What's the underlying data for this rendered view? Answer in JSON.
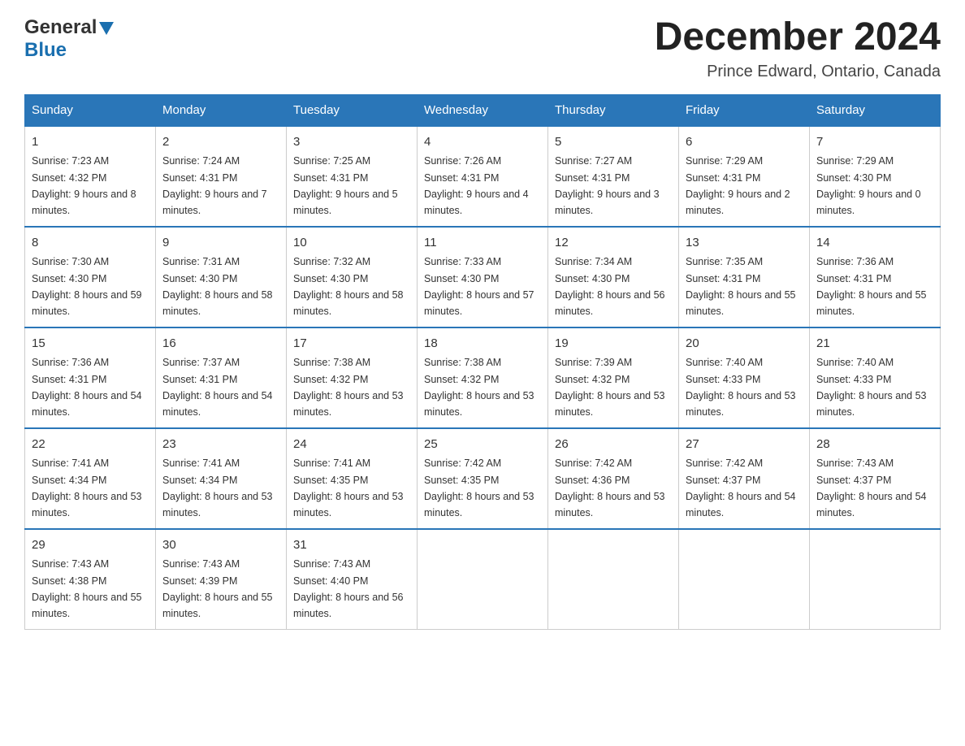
{
  "header": {
    "logo_general": "General",
    "logo_blue": "Blue",
    "title": "December 2024",
    "subtitle": "Prince Edward, Ontario, Canada"
  },
  "columns": [
    "Sunday",
    "Monday",
    "Tuesday",
    "Wednesday",
    "Thursday",
    "Friday",
    "Saturday"
  ],
  "weeks": [
    [
      {
        "day": "1",
        "sunrise": "Sunrise: 7:23 AM",
        "sunset": "Sunset: 4:32 PM",
        "daylight": "Daylight: 9 hours and 8 minutes."
      },
      {
        "day": "2",
        "sunrise": "Sunrise: 7:24 AM",
        "sunset": "Sunset: 4:31 PM",
        "daylight": "Daylight: 9 hours and 7 minutes."
      },
      {
        "day": "3",
        "sunrise": "Sunrise: 7:25 AM",
        "sunset": "Sunset: 4:31 PM",
        "daylight": "Daylight: 9 hours and 5 minutes."
      },
      {
        "day": "4",
        "sunrise": "Sunrise: 7:26 AM",
        "sunset": "Sunset: 4:31 PM",
        "daylight": "Daylight: 9 hours and 4 minutes."
      },
      {
        "day": "5",
        "sunrise": "Sunrise: 7:27 AM",
        "sunset": "Sunset: 4:31 PM",
        "daylight": "Daylight: 9 hours and 3 minutes."
      },
      {
        "day": "6",
        "sunrise": "Sunrise: 7:29 AM",
        "sunset": "Sunset: 4:31 PM",
        "daylight": "Daylight: 9 hours and 2 minutes."
      },
      {
        "day": "7",
        "sunrise": "Sunrise: 7:29 AM",
        "sunset": "Sunset: 4:30 PM",
        "daylight": "Daylight: 9 hours and 0 minutes."
      }
    ],
    [
      {
        "day": "8",
        "sunrise": "Sunrise: 7:30 AM",
        "sunset": "Sunset: 4:30 PM",
        "daylight": "Daylight: 8 hours and 59 minutes."
      },
      {
        "day": "9",
        "sunrise": "Sunrise: 7:31 AM",
        "sunset": "Sunset: 4:30 PM",
        "daylight": "Daylight: 8 hours and 58 minutes."
      },
      {
        "day": "10",
        "sunrise": "Sunrise: 7:32 AM",
        "sunset": "Sunset: 4:30 PM",
        "daylight": "Daylight: 8 hours and 58 minutes."
      },
      {
        "day": "11",
        "sunrise": "Sunrise: 7:33 AM",
        "sunset": "Sunset: 4:30 PM",
        "daylight": "Daylight: 8 hours and 57 minutes."
      },
      {
        "day": "12",
        "sunrise": "Sunrise: 7:34 AM",
        "sunset": "Sunset: 4:30 PM",
        "daylight": "Daylight: 8 hours and 56 minutes."
      },
      {
        "day": "13",
        "sunrise": "Sunrise: 7:35 AM",
        "sunset": "Sunset: 4:31 PM",
        "daylight": "Daylight: 8 hours and 55 minutes."
      },
      {
        "day": "14",
        "sunrise": "Sunrise: 7:36 AM",
        "sunset": "Sunset: 4:31 PM",
        "daylight": "Daylight: 8 hours and 55 minutes."
      }
    ],
    [
      {
        "day": "15",
        "sunrise": "Sunrise: 7:36 AM",
        "sunset": "Sunset: 4:31 PM",
        "daylight": "Daylight: 8 hours and 54 minutes."
      },
      {
        "day": "16",
        "sunrise": "Sunrise: 7:37 AM",
        "sunset": "Sunset: 4:31 PM",
        "daylight": "Daylight: 8 hours and 54 minutes."
      },
      {
        "day": "17",
        "sunrise": "Sunrise: 7:38 AM",
        "sunset": "Sunset: 4:32 PM",
        "daylight": "Daylight: 8 hours and 53 minutes."
      },
      {
        "day": "18",
        "sunrise": "Sunrise: 7:38 AM",
        "sunset": "Sunset: 4:32 PM",
        "daylight": "Daylight: 8 hours and 53 minutes."
      },
      {
        "day": "19",
        "sunrise": "Sunrise: 7:39 AM",
        "sunset": "Sunset: 4:32 PM",
        "daylight": "Daylight: 8 hours and 53 minutes."
      },
      {
        "day": "20",
        "sunrise": "Sunrise: 7:40 AM",
        "sunset": "Sunset: 4:33 PM",
        "daylight": "Daylight: 8 hours and 53 minutes."
      },
      {
        "day": "21",
        "sunrise": "Sunrise: 7:40 AM",
        "sunset": "Sunset: 4:33 PM",
        "daylight": "Daylight: 8 hours and 53 minutes."
      }
    ],
    [
      {
        "day": "22",
        "sunrise": "Sunrise: 7:41 AM",
        "sunset": "Sunset: 4:34 PM",
        "daylight": "Daylight: 8 hours and 53 minutes."
      },
      {
        "day": "23",
        "sunrise": "Sunrise: 7:41 AM",
        "sunset": "Sunset: 4:34 PM",
        "daylight": "Daylight: 8 hours and 53 minutes."
      },
      {
        "day": "24",
        "sunrise": "Sunrise: 7:41 AM",
        "sunset": "Sunset: 4:35 PM",
        "daylight": "Daylight: 8 hours and 53 minutes."
      },
      {
        "day": "25",
        "sunrise": "Sunrise: 7:42 AM",
        "sunset": "Sunset: 4:35 PM",
        "daylight": "Daylight: 8 hours and 53 minutes."
      },
      {
        "day": "26",
        "sunrise": "Sunrise: 7:42 AM",
        "sunset": "Sunset: 4:36 PM",
        "daylight": "Daylight: 8 hours and 53 minutes."
      },
      {
        "day": "27",
        "sunrise": "Sunrise: 7:42 AM",
        "sunset": "Sunset: 4:37 PM",
        "daylight": "Daylight: 8 hours and 54 minutes."
      },
      {
        "day": "28",
        "sunrise": "Sunrise: 7:43 AM",
        "sunset": "Sunset: 4:37 PM",
        "daylight": "Daylight: 8 hours and 54 minutes."
      }
    ],
    [
      {
        "day": "29",
        "sunrise": "Sunrise: 7:43 AM",
        "sunset": "Sunset: 4:38 PM",
        "daylight": "Daylight: 8 hours and 55 minutes."
      },
      {
        "day": "30",
        "sunrise": "Sunrise: 7:43 AM",
        "sunset": "Sunset: 4:39 PM",
        "daylight": "Daylight: 8 hours and 55 minutes."
      },
      {
        "day": "31",
        "sunrise": "Sunrise: 7:43 AM",
        "sunset": "Sunset: 4:40 PM",
        "daylight": "Daylight: 8 hours and 56 minutes."
      },
      null,
      null,
      null,
      null
    ]
  ]
}
